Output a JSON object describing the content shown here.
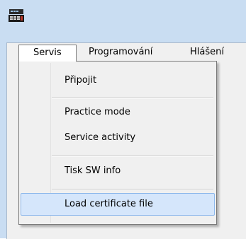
{
  "window": {
    "app_icon": "cash-register-icon"
  },
  "menubar": {
    "items": [
      {
        "label": "Servis"
      },
      {
        "label": "Programování"
      },
      {
        "label": "Hlášení"
      }
    ]
  },
  "dropdown": {
    "items": [
      {
        "label": "Připojit"
      },
      {
        "label": "Practice mode"
      },
      {
        "label": "Service activity"
      },
      {
        "label": "Tisk SW info"
      },
      {
        "label": "Load certificate file"
      }
    ]
  },
  "colors": {
    "highlight_bg": "#d5e6fb",
    "highlight_border": "#8db8ec",
    "window_frame": "#c9ddf2"
  }
}
